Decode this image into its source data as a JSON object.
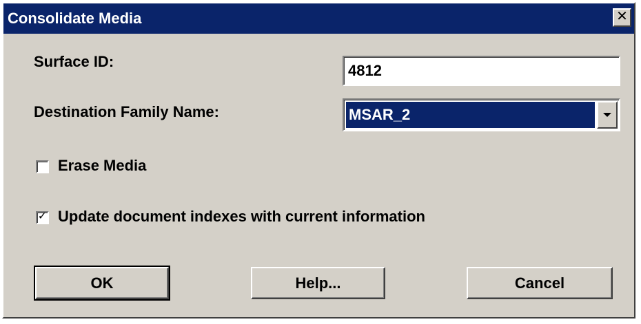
{
  "window": {
    "title": "Consolidate Media",
    "close_label": "✕"
  },
  "form": {
    "surface_id_label": "Surface ID:",
    "surface_id_value": "4812",
    "destination_label": "Destination Family Name:",
    "destination_value": "MSAR_2",
    "erase_media_label": "Erase Media",
    "erase_media_checked": false,
    "update_indexes_label": "Update document indexes with current information",
    "update_indexes_checked": true
  },
  "buttons": {
    "ok": "OK",
    "help": "Help...",
    "cancel": "Cancel"
  },
  "colors": {
    "face": "#d4d0c8",
    "titlebar": "#0a246a",
    "selection": "#0a246a"
  }
}
